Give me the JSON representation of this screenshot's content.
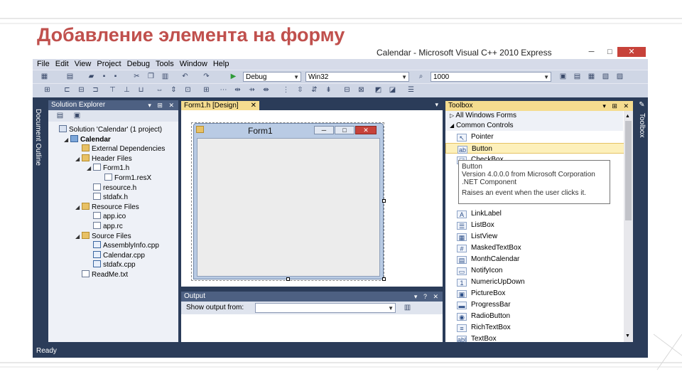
{
  "slide": {
    "title": "Добавление элемента на форму"
  },
  "window": {
    "title": "Calendar - Microsoft Visual C++ 2010 Express",
    "controls": {
      "minimize": "─",
      "maximize": "□",
      "close": "✕"
    }
  },
  "menu": [
    "File",
    "Edit",
    "View",
    "Project",
    "Debug",
    "Tools",
    "Window",
    "Help"
  ],
  "toolbar": {
    "config_value": "Debug",
    "platform_value": "Win32",
    "find_value": "1000"
  },
  "solution_explorer": {
    "header": "Solution Explorer",
    "buttons": "▾ ⊞ ✕",
    "tree": [
      {
        "label": "Solution 'Calendar' (1 project)",
        "icon": "solution-icon",
        "level": 0,
        "arrow": ""
      },
      {
        "label": "Calendar",
        "icon": "project-icon",
        "level": 1,
        "arrow": "◢",
        "bold": true
      },
      {
        "label": "External Dependencies",
        "icon": "folder-icon",
        "level": 2,
        "arrow": ""
      },
      {
        "label": "Header Files",
        "icon": "folder-icon",
        "level": 2,
        "arrow": "◢"
      },
      {
        "label": "Form1.h",
        "icon": "header-file-icon",
        "level": 3,
        "arrow": "◢"
      },
      {
        "label": "Form1.resX",
        "icon": "resx-file-icon",
        "level": 4,
        "arrow": ""
      },
      {
        "label": "resource.h",
        "icon": "header-file-icon",
        "level": 3,
        "arrow": ""
      },
      {
        "label": "stdafx.h",
        "icon": "header-file-icon",
        "level": 3,
        "arrow": ""
      },
      {
        "label": "Resource Files",
        "icon": "folder-icon",
        "level": 2,
        "arrow": "◢"
      },
      {
        "label": "app.ico",
        "icon": "icon-file-icon",
        "level": 3,
        "arrow": ""
      },
      {
        "label": "app.rc",
        "icon": "rc-file-icon",
        "level": 3,
        "arrow": ""
      },
      {
        "label": "Source Files",
        "icon": "folder-icon",
        "level": 2,
        "arrow": "◢"
      },
      {
        "label": "AssemblyInfo.cpp",
        "icon": "cpp-file-icon",
        "level": 3,
        "arrow": ""
      },
      {
        "label": "Calendar.cpp",
        "icon": "cpp-file-icon",
        "level": 3,
        "arrow": ""
      },
      {
        "label": "stdafx.cpp",
        "icon": "cpp-file-icon",
        "level": 3,
        "arrow": ""
      },
      {
        "label": "ReadMe.txt",
        "icon": "text-file-icon",
        "level": 2,
        "arrow": ""
      }
    ]
  },
  "side_tabs": {
    "left": "Document Outline",
    "right": "Toolbox"
  },
  "designer": {
    "tab": "Form1.h [Design]",
    "tab_close": "✕",
    "form_title": "Form1"
  },
  "output": {
    "header": "Output",
    "buttons": "▾ ? ✕",
    "label": "Show output from:"
  },
  "toolbox": {
    "header": "Toolbox",
    "buttons": "▾ ⊞ ✕",
    "groups": [
      "All Windows Forms",
      "Common Controls"
    ],
    "items": [
      {
        "label": "Pointer",
        "icon": "↖"
      },
      {
        "label": "Button",
        "icon": "ab"
      },
      {
        "label": "CheckBox",
        "icon": "☑"
      },
      {
        "label": "LinkLabel",
        "icon": "A"
      },
      {
        "label": "ListBox",
        "icon": "☰"
      },
      {
        "label": "ListView",
        "icon": "▦"
      },
      {
        "label": "MaskedTextBox",
        "icon": "#"
      },
      {
        "label": "MonthCalendar",
        "icon": "▤"
      },
      {
        "label": "NotifyIcon",
        "icon": "▭"
      },
      {
        "label": "NumericUpDown",
        "icon": "1"
      },
      {
        "label": "PictureBox",
        "icon": "▣"
      },
      {
        "label": "ProgressBar",
        "icon": "▬"
      },
      {
        "label": "RadioButton",
        "icon": "◉"
      },
      {
        "label": "RichTextBox",
        "icon": "≡"
      },
      {
        "label": "TextBox",
        "icon": "abl"
      }
    ],
    "tooltip": {
      "line1": "Button",
      "line2": "Version 4.0.0.0 from Microsoft Corporation",
      "line3": ".NET Component",
      "line4": "Raises an event when the user clicks it."
    }
  },
  "status": {
    "text": "Ready"
  }
}
